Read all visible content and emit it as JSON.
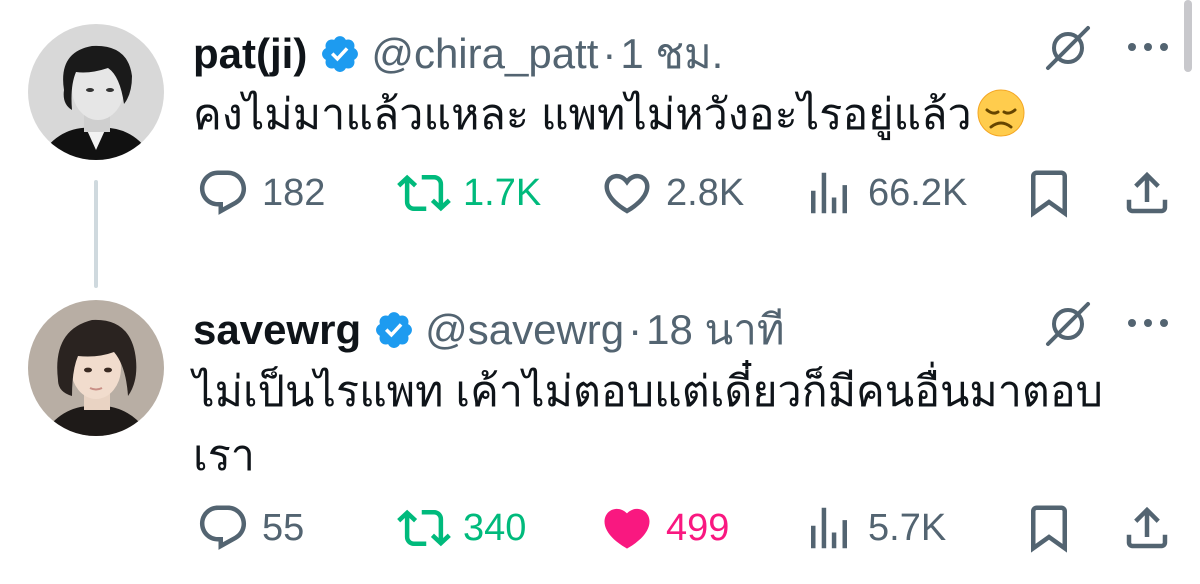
{
  "tweets": [
    {
      "name": "pat(ji)",
      "handle": "@chira_patt",
      "separator": "·",
      "time": "1 ชม.",
      "text": "คงไม่มาแล้วแหละ แพทไม่หวังอะไรอยู่แล้ว",
      "emoji_icon": "disappointed-face-icon",
      "replies": "182",
      "retweets": "1.7K",
      "likes": "2.8K",
      "views": "66.2K",
      "liked": false
    },
    {
      "name": "savewrg",
      "handle": "@savewrg",
      "separator": "·",
      "time": "18 นาที",
      "text_line1": "ไม่เป็นไรแพท เค้าไม่ตอบแต่เดี๋ยวก็มีคนอื่นมาตอบ",
      "text_line2": "เรา",
      "replies": "55",
      "retweets": "340",
      "likes": "499",
      "views": "5.7K",
      "liked": true
    }
  ],
  "colors": {
    "text": "#0f1419",
    "secondary": "#536471",
    "verified": "#1d9bf0",
    "retweet": "#00ba7c",
    "like": "#f91880",
    "thread_line": "#cfd9de"
  }
}
